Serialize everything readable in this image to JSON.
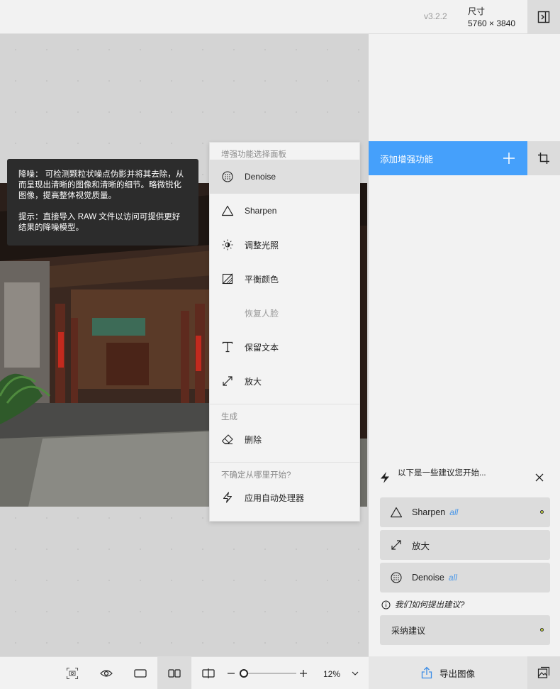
{
  "header": {
    "version": "v3.2.2",
    "dimensions_label": "尺寸",
    "dimensions_value": "5760 × 3840"
  },
  "tooltip": {
    "description": "降噪： 可检测颗粒状噪点伪影并将其去除，从而呈现出清晰的图像和清晰的细节。略微锐化图像，提高整体视觉质量。",
    "hint": "提示：直接导入 RAW 文件以访问可提供更好结果的降噪模型。"
  },
  "menu": {
    "header_enhance": "增强功能选择面板",
    "items": [
      {
        "label": "Denoise",
        "icon": "denoise-icon"
      },
      {
        "label": "Sharpen",
        "icon": "sharpen-icon"
      },
      {
        "label": "调整光照",
        "icon": "light-icon"
      },
      {
        "label": "平衡颜色",
        "icon": "color-icon"
      },
      {
        "label": "恢复人脸",
        "icon": "face-icon"
      },
      {
        "label": "保留文本",
        "icon": "text-icon"
      },
      {
        "label": "放大",
        "icon": "upscale-icon"
      }
    ],
    "header_generate": "生成",
    "erase_label": "删除",
    "header_unsure": "不确定从哪里开始?",
    "autopilot_label": "应用自动处理器"
  },
  "sidepanel": {
    "add_enhancement": "添加增强功能",
    "suggestions_title": "以下是一些建议您开始...",
    "suggestions": [
      {
        "label": "Sharpen",
        "all": "all"
      },
      {
        "label": "放大",
        "all": ""
      },
      {
        "label": "Denoise",
        "all": "all"
      }
    ],
    "how_label": "我们如何提出建议?",
    "accept_label": "采纳建议",
    "export_label": "导出图像"
  },
  "bottombar": {
    "zoom_level": "12%",
    "zoom_fraction": 0.08
  },
  "colors": {
    "accent": "#45a0fb",
    "tooltip_bg": "#2c2c2c",
    "dot": "#c8d640"
  }
}
